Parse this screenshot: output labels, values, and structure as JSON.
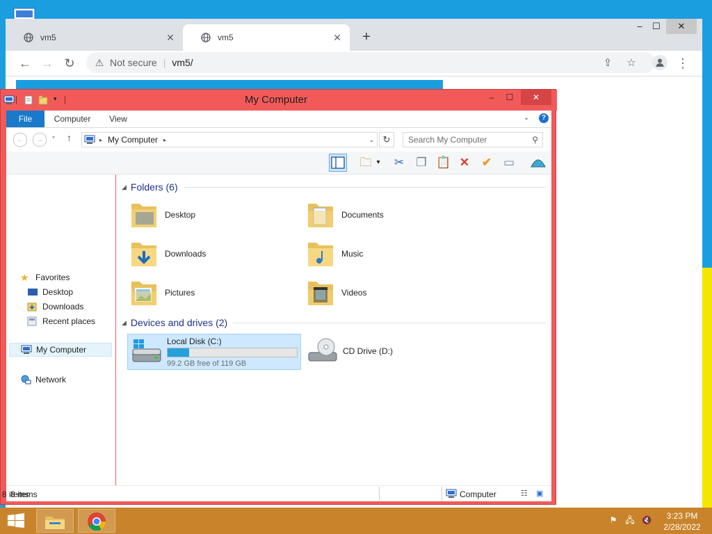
{
  "browser": {
    "tabs": [
      {
        "title": "vm5",
        "active": false
      },
      {
        "title": "vm5",
        "active": true
      }
    ],
    "new_tab_icon": "plus-icon",
    "address": {
      "security": "Not secure",
      "url": "vm5/"
    }
  },
  "explorer": {
    "title": "My Computer",
    "ribbon_tabs": [
      "File",
      "Computer",
      "View"
    ],
    "breadcrumb": "My Computer",
    "search_placeholder": "Search My Computer",
    "nav": {
      "favorites": "Favorites",
      "favorites_items": [
        "Desktop",
        "Downloads",
        "Recent places"
      ],
      "my_computer": "My Computer",
      "network": "Network"
    },
    "folders_header": "Folders (6)",
    "folders": [
      {
        "name": "Desktop",
        "icon": "desktop-folder-icon"
      },
      {
        "name": "Documents",
        "icon": "documents-folder-icon"
      },
      {
        "name": "Downloads",
        "icon": "downloads-folder-icon"
      },
      {
        "name": "Music",
        "icon": "music-folder-icon"
      },
      {
        "name": "Pictures",
        "icon": "pictures-folder-icon"
      },
      {
        "name": "Videos",
        "icon": "videos-folder-icon"
      }
    ],
    "drives_header": "Devices and drives (2)",
    "drives": [
      {
        "name": "Local Disk (C:)",
        "free_text": "99.2 GB free of 119 GB",
        "used_fraction": 0.166
      },
      {
        "name": "CD Drive (D:)"
      }
    ],
    "status_inner": "8 items",
    "status_outer_left": "8 items",
    "status_outer_right": "Computer"
  },
  "taskbar": {
    "time": "3:23 PM",
    "date": "2/28/2022"
  },
  "colors": {
    "explorer_frame": "#f25a5a",
    "taskbar": "#c9842b",
    "desktop": "#1a9ee0",
    "ribbon_file": "#1979ca"
  }
}
